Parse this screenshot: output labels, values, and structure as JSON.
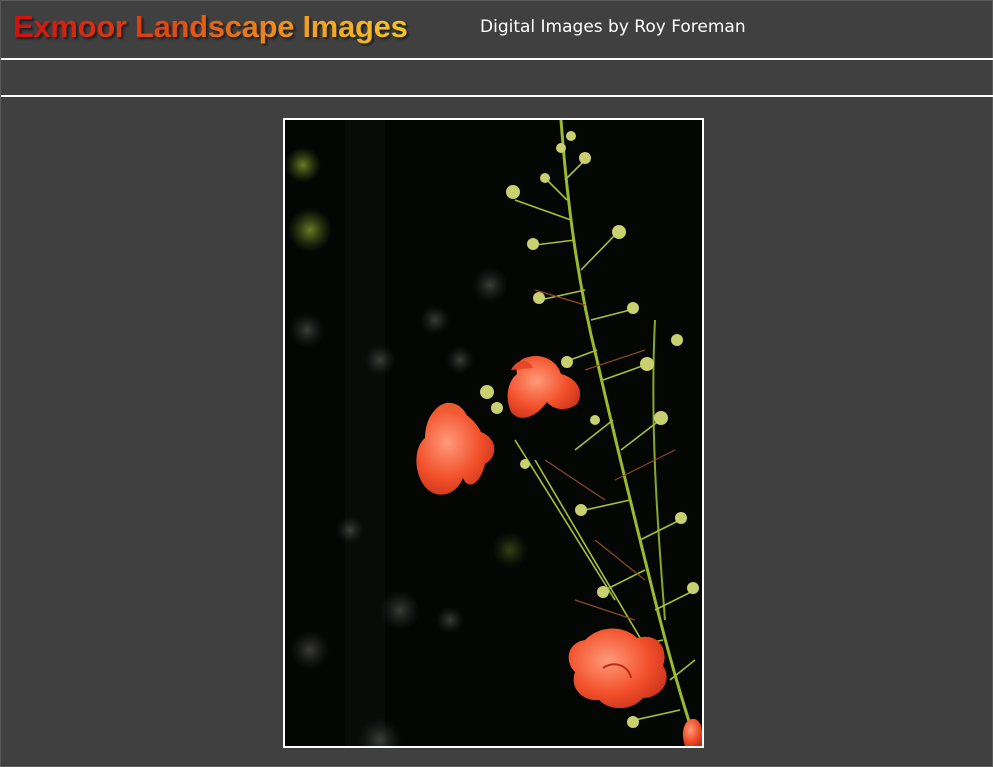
{
  "header": {
    "site_title": "Exmoor Landscape Images",
    "site_subtitle": "Digital Images by Roy Foreman"
  },
  "main": {
    "photo": {
      "subject": "orange-red wildflowers on a green stem against dark background"
    }
  },
  "colors": {
    "page_background": "#404040",
    "rule_color": "#ffffff",
    "title_gradient_start": "#d01010",
    "title_gradient_end": "#f5c428",
    "subtitle_color": "#ffffff"
  }
}
